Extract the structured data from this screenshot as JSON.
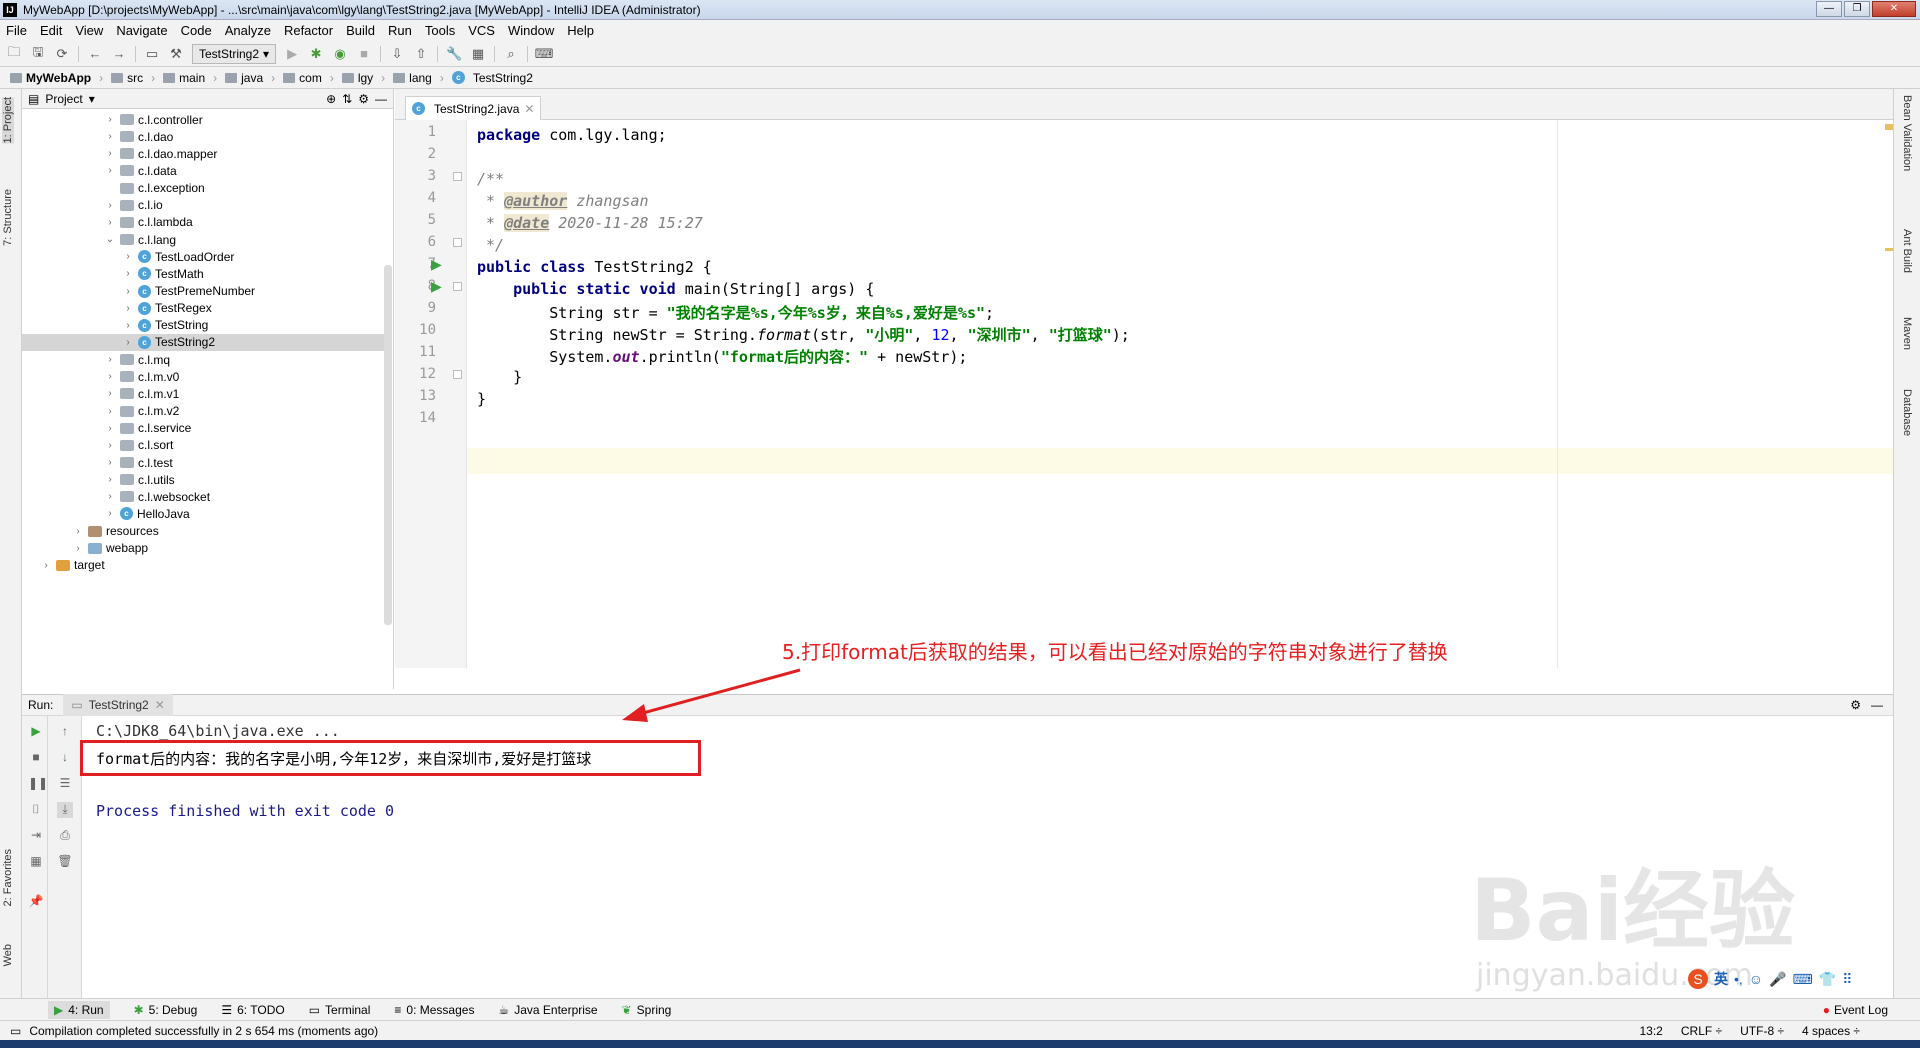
{
  "window": {
    "title": "MyWebApp [D:\\projects\\MyWebApp] - ...\\src\\main\\java\\com\\lgy\\lang\\TestString2.java [MyWebApp] - IntelliJ IDEA (Administrator)"
  },
  "menu": [
    "File",
    "Edit",
    "View",
    "Navigate",
    "Code",
    "Analyze",
    "Refactor",
    "Build",
    "Run",
    "Tools",
    "VCS",
    "Window",
    "Help"
  ],
  "toolbar": {
    "run_config": "TestString2"
  },
  "breadcrumb": [
    "MyWebApp",
    "src",
    "main",
    "java",
    "com",
    "lgy",
    "lang",
    "TestString2"
  ],
  "left_tabs": {
    "project": "1: Project",
    "structure": "7: Structure",
    "favorites": "2: Favorites",
    "web": "Web"
  },
  "project_panel": {
    "header": "Project",
    "tree": [
      {
        "label": "c.l.controller",
        "kind": "pkg",
        "arrow": "›"
      },
      {
        "label": "c.l.dao",
        "kind": "pkg",
        "arrow": "›"
      },
      {
        "label": "c.l.dao.mapper",
        "kind": "pkg",
        "arrow": "›"
      },
      {
        "label": "c.l.data",
        "kind": "pkg",
        "arrow": "›"
      },
      {
        "label": "c.l.exception",
        "kind": "pkg",
        "arrow": ""
      },
      {
        "label": "c.l.io",
        "kind": "pkg",
        "arrow": "›"
      },
      {
        "label": "c.l.lambda",
        "kind": "pkg",
        "arrow": "›"
      },
      {
        "label": "c.l.lang",
        "kind": "pkg",
        "arrow": "⌄"
      },
      {
        "label": "TestLoadOrder",
        "kind": "cls",
        "arrow": "›"
      },
      {
        "label": "TestMath",
        "kind": "cls",
        "arrow": "›"
      },
      {
        "label": "TestPremeNumber",
        "kind": "cls",
        "arrow": "›"
      },
      {
        "label": "TestRegex",
        "kind": "cls",
        "arrow": "›"
      },
      {
        "label": "TestString",
        "kind": "cls",
        "arrow": "›"
      },
      {
        "label": "TestString2",
        "kind": "cls",
        "arrow": "›"
      },
      {
        "label": "c.l.mq",
        "kind": "pkg",
        "arrow": "›"
      },
      {
        "label": "c.l.m.v0",
        "kind": "pkg",
        "arrow": "›"
      },
      {
        "label": "c.l.m.v1",
        "kind": "pkg",
        "arrow": "›"
      },
      {
        "label": "c.l.m.v2",
        "kind": "pkg",
        "arrow": "›"
      },
      {
        "label": "c.l.service",
        "kind": "pkg",
        "arrow": "›"
      },
      {
        "label": "c.l.sort",
        "kind": "pkg",
        "arrow": "›"
      },
      {
        "label": "c.l.test",
        "kind": "pkg",
        "arrow": "›"
      },
      {
        "label": "c.l.utils",
        "kind": "pkg",
        "arrow": "›"
      },
      {
        "label": "c.l.websocket",
        "kind": "pkg",
        "arrow": "›"
      },
      {
        "label": "HelloJava",
        "kind": "cls",
        "arrow": "›"
      },
      {
        "label": "resources",
        "kind": "res",
        "arrow": "›"
      },
      {
        "label": "webapp",
        "kind": "web",
        "arrow": "›"
      },
      {
        "label": "target",
        "kind": "tgt",
        "arrow": "›"
      }
    ]
  },
  "editor": {
    "tab": "TestString2.java",
    "line_numbers": [
      "1",
      "2",
      "3",
      "4",
      "5",
      "6",
      "7",
      "8",
      "9",
      "10",
      "11",
      "12",
      "13",
      "14"
    ],
    "code": {
      "l1_kw": "package",
      "l1_rest": " com.lgy.lang;",
      "l3": "/**",
      "l4_pre": " * ",
      "l4_tag": "@author",
      "l4_rest": " zhangsan",
      "l5_pre": " * ",
      "l5_tag": "@date",
      "l5_rest": " 2020-11-28 15:27",
      "l6": " */",
      "l7_kw": "public class",
      "l7_rest": " TestString2 {",
      "l8_kw": "    public static void",
      "l8_rest": " main(String[] args) {",
      "l9_a": "        String str = ",
      "l9_str": "\"我的名字是%s,今年%s岁，来自%s,爱好是%s\"",
      "l9_b": ";",
      "l10_a": "        String newStr = String.",
      "l10_m": "format",
      "l10_b": "(str, ",
      "l10_s1": "\"小明\"",
      "l10_c": ", ",
      "l10_n": "12",
      "l10_d": ", ",
      "l10_s2": "\"深圳市\"",
      "l10_e": ", ",
      "l10_s3": "\"打篮球\"",
      "l10_f": ");",
      "l11_a": "        System.",
      "l11_out": "out",
      "l11_b": ".println(",
      "l11_str": "\"format后的内容：\"",
      "l11_c": " + newStr);",
      "l12": "    }",
      "l13": "}"
    }
  },
  "right_tabs": [
    "Bean Validation",
    "Ant Build",
    "Maven",
    "Database"
  ],
  "run_panel": {
    "label": "Run:",
    "tab": "TestString2",
    "console": {
      "cmd": "C:\\JDK8_64\\bin\\java.exe ...",
      "output": "format后的内容：我的名字是小明,今年12岁，来自深圳市,爱好是打篮球",
      "exit": "Process finished with exit code 0"
    }
  },
  "annotation": "5.打印format后获取的结果，可以看出已经对原始的字符串对象进行了替换",
  "bottom_tabs": [
    "4: Run",
    "5: Debug",
    "6: TODO",
    "Terminal",
    "0: Messages",
    "Java Enterprise",
    "Spring"
  ],
  "event_log": "Event Log",
  "status": {
    "message": "Compilation completed successfully in 2 s 654 ms (moments ago)",
    "position": "13:2",
    "line_sep": "CRLF ÷",
    "encoding": "UTF-8 ÷",
    "indent": "4 spaces ÷"
  },
  "watermark": {
    "main": "Bai经验",
    "sub": "jingyan.baidu.com"
  },
  "ime": "英"
}
